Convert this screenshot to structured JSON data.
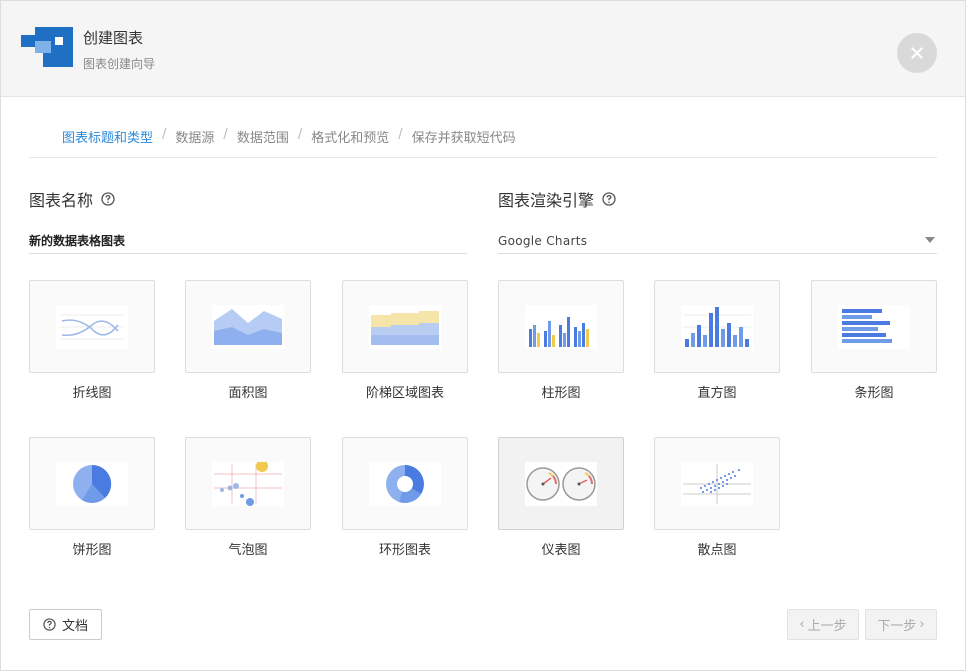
{
  "header": {
    "title": "创建图表",
    "subtitle": "图表创建向导"
  },
  "steps": [
    "图表标题和类型",
    "数据源",
    "数据范围",
    "格式化和预览",
    "保存并获取短代码"
  ],
  "active_step": 0,
  "chart_name": {
    "label": "图表名称",
    "value": "新的数据表格图表"
  },
  "render_engine": {
    "label": "图表渲染引擎",
    "value": "Google Charts"
  },
  "chart_types": [
    {
      "label": "折线图",
      "icon": "line-chart-icon"
    },
    {
      "label": "面积图",
      "icon": "area-chart-icon"
    },
    {
      "label": "阶梯区域图表",
      "icon": "stepped-area-chart-icon"
    },
    {
      "label": "柱形图",
      "icon": "column-chart-icon"
    },
    {
      "label": "直方图",
      "icon": "histogram-icon"
    },
    {
      "label": "条形图",
      "icon": "bar-chart-icon"
    },
    {
      "label": "饼形图",
      "icon": "pie-chart-icon"
    },
    {
      "label": "气泡图",
      "icon": "bubble-chart-icon"
    },
    {
      "label": "环形图表",
      "icon": "donut-chart-icon"
    },
    {
      "label": "仪表图",
      "icon": "gauge-chart-icon"
    },
    {
      "label": "散点图",
      "icon": "scatter-chart-icon"
    }
  ],
  "selected_chart_type": 9,
  "footer": {
    "docs_label": "文档",
    "prev_label": "上一步",
    "next_label": "下一步"
  },
  "colors": {
    "accent": "#2d89d8",
    "chart_blue": "#4a7be0",
    "chart_yellow": "#f2c94c"
  }
}
